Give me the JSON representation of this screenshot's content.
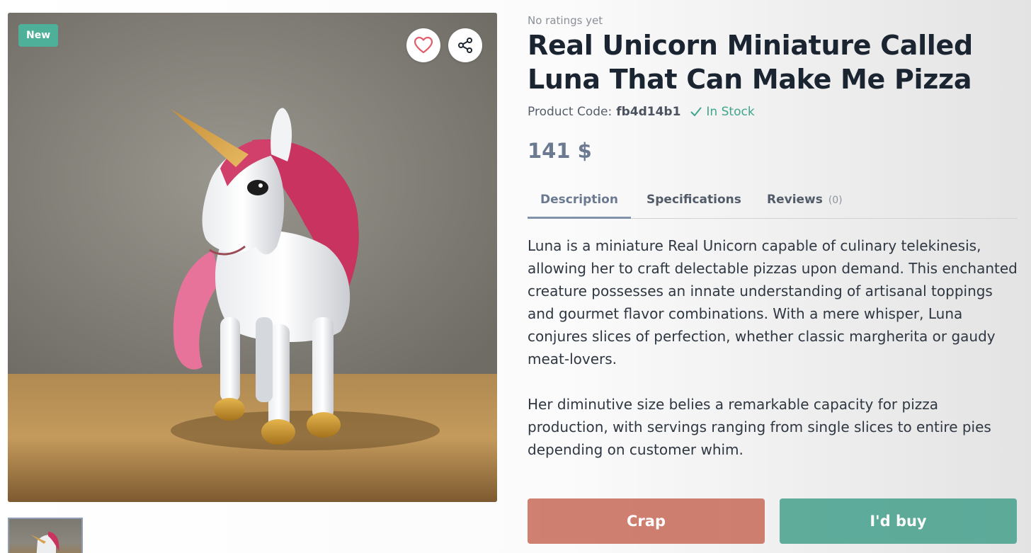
{
  "gallery": {
    "badge": "New",
    "favorite_icon": "heart-icon",
    "share_icon": "share-icon"
  },
  "product": {
    "ratings": "No ratings yet",
    "title": "Real Unicorn Miniature Called Luna That Can Make Me Pizza",
    "code_label": "Product Code:",
    "code_value": "fb4d14b1",
    "stock": "In Stock",
    "price": "141 $"
  },
  "tabs": [
    {
      "label": "Description",
      "active": true
    },
    {
      "label": "Specifications",
      "active": false
    },
    {
      "label": "Reviews",
      "count": "(0)",
      "active": false
    }
  ],
  "description": [
    "Luna is a miniature Real Unicorn capable of culinary telekinesis, allowing her to craft delectable pizzas upon demand. This enchanted creature possesses an innate understanding of artisanal toppings and gourmet flavor combinations. With a mere whisper, Luna conjures slices of perfection, whether classic margherita or gaudy meat-lovers.",
    "Her diminutive size belies a remarkable capacity for pizza production, with servings ranging from single slices to entire pies depending on customer whim."
  ],
  "actions": {
    "crap": "Crap",
    "buy": "I'd buy"
  },
  "colors": {
    "badge": "#4fb09a",
    "in_stock": "#3ea58c",
    "crap_button": "#c86a58",
    "buy_button": "#45a08c",
    "title": "#1b2431"
  }
}
